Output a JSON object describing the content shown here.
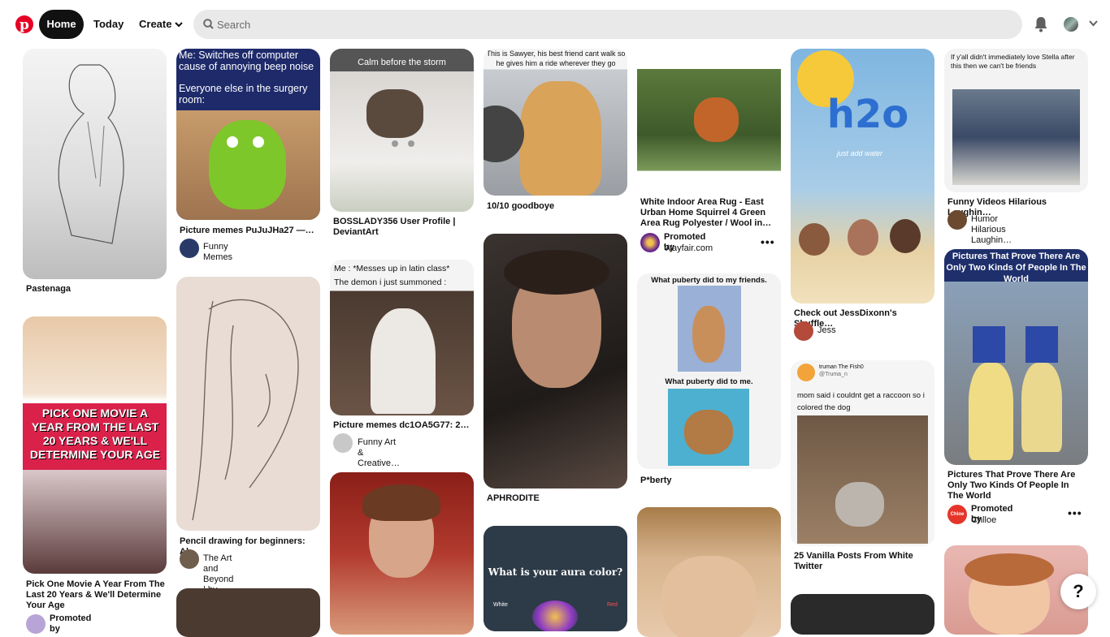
{
  "header": {
    "home_label": "Home",
    "today_label": "Today",
    "create_label": "Create",
    "search_placeholder": "Search"
  },
  "pins": [
    {
      "id": "pastenaga",
      "caption": "Pastenaga"
    },
    {
      "id": "mean-girls",
      "caption": "Pick One Movie A Year From The Last 20 Years & We'll Determine Your Age",
      "overlay": "PICK ONE MOVIE A YEAR FROM THE LAST 20 YEARS & WE'LL DETERMINE YOUR AGE",
      "promoted": "Promoted by"
    },
    {
      "id": "mike-meme",
      "caption": "Picture memes PuJuJHa27 —…",
      "overlay_top": "Me: Switches off computer cause of annoying beep noise",
      "overlay_mid": "Everyone else in the surgery room:",
      "author": "Funny Memes"
    },
    {
      "id": "pencil",
      "caption": "Pencil drawing for beginners: Al…",
      "author": "The Art and Beyond | by…"
    },
    {
      "id": "cat",
      "caption": "BOSSLADY356 User Profile | DeviantArt",
      "overlay": "Calm before the storm"
    },
    {
      "id": "dog-latin",
      "caption": "Picture memes dc1OA5G77: 2…",
      "overlay": "Me : *Messes up in latin class*\nThe demon i just summoned :",
      "author": "Funny Art & Creative…"
    },
    {
      "id": "sawyer",
      "caption": "10/10 goodboye",
      "overlay": "This is Sawyer, his best friend cant walk so he gives him a ride wherever they go"
    },
    {
      "id": "aphrodite",
      "caption": "APHRODITE"
    },
    {
      "id": "aura",
      "overlay": "What is your aura color?",
      "white_label": "White",
      "red_label": "Red"
    },
    {
      "id": "rug",
      "caption": "White Indoor Area Rug - East Urban Home Squirrel 4 Green Area Rug Polyester / Wool in…",
      "promoted": "Promoted by",
      "author": "Wayfair.com"
    },
    {
      "id": "puberty",
      "caption": "P*berty",
      "overlay_top": "What puberty did to my friends.",
      "overlay_mid": "What puberty did to me."
    },
    {
      "id": "h2o",
      "caption": "Check out JessDixonn's Shuffle…",
      "author": "Jess",
      "overlay": "h2o",
      "overlay_sub": "just add water"
    },
    {
      "id": "raccoon",
      "caption": "25 Vanilla Posts From White Twitter",
      "tweet_name": "truman The Fish0",
      "tweet_handle": "@Truma_n",
      "tweet_text": "mom said i couldnt get a raccoon so i colored the dog"
    },
    {
      "id": "stella",
      "caption": "Funny Videos Hilarious Laughin…",
      "author": "Humor Hilarious Laughin…",
      "overlay": "If y'all didn't immediately love Stella after this then we can't be friends"
    },
    {
      "id": "snowwhite",
      "caption": "Pictures That Prove There Are Only Two Kinds Of People In The World",
      "overlay": "Pictures That Prove There Are Only Two Kinds Of People In The World",
      "promoted": "Promoted by",
      "author": "Chlloe",
      "brand": "Chloe"
    }
  ],
  "help_label": "?",
  "colors": {
    "brand": "#e60023",
    "search_bg": "#e9e9e9"
  }
}
